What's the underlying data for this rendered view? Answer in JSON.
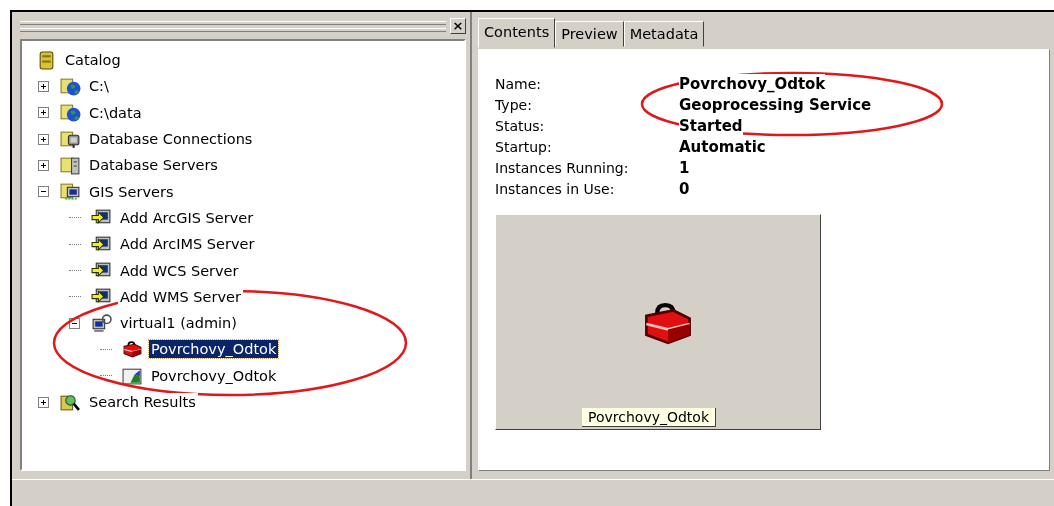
{
  "catalog_panel": {
    "close": "×",
    "tree": [
      {
        "label": "Catalog",
        "kind": "catalog",
        "selected": false,
        "children": [
          {
            "label": "C:\\",
            "kind": "drive",
            "expanded": false,
            "selected": false
          },
          {
            "label": "C:\\data",
            "kind": "drive",
            "expanded": false,
            "selected": false
          },
          {
            "label": "Database Connections",
            "kind": "database",
            "expanded": false,
            "selected": false
          },
          {
            "label": "Database Servers",
            "kind": "dbserver",
            "expanded": false,
            "selected": false
          },
          {
            "label": "GIS Servers",
            "kind": "gisservers",
            "expanded": true,
            "selected": false,
            "children": [
              {
                "label": "Add ArcGIS Server",
                "kind": "addserver",
                "selected": false
              },
              {
                "label": "Add ArcIMS Server",
                "kind": "addserver",
                "selected": false
              },
              {
                "label": "Add WCS Server",
                "kind": "addserver",
                "selected": false
              },
              {
                "label": "Add WMS Server",
                "kind": "addserver",
                "selected": false
              },
              {
                "label": "virtual1 (admin)",
                "kind": "server",
                "expanded": true,
                "selected": false,
                "children": [
                  {
                    "label": "Povrchovy_Odtok",
                    "kind": "toolbox",
                    "selected": true
                  },
                  {
                    "label": "Povrchovy_Odtok",
                    "kind": "map",
                    "selected": false
                  }
                ]
              }
            ]
          },
          {
            "label": "Search Results",
            "kind": "search",
            "expanded": false,
            "selected": false
          }
        ]
      }
    ]
  },
  "details_panel": {
    "tabs": [
      {
        "label": "Contents",
        "selected": true
      },
      {
        "label": "Preview",
        "selected": false
      },
      {
        "label": "Metadata",
        "selected": false
      }
    ],
    "properties": [
      {
        "label": "Name:",
        "value": "Povrchovy_Odtok"
      },
      {
        "label": "Type:",
        "value": "Geoprocessing Service"
      },
      {
        "label": "Status:",
        "value": "Started"
      },
      {
        "label": "Startup:",
        "value": "Automatic"
      },
      {
        "label": "Instances Running:",
        "value": "1"
      },
      {
        "label": "Instances in Use:",
        "value": "0"
      }
    ],
    "thumbnail": {
      "caption": "Povrchovy_Odtok"
    }
  }
}
